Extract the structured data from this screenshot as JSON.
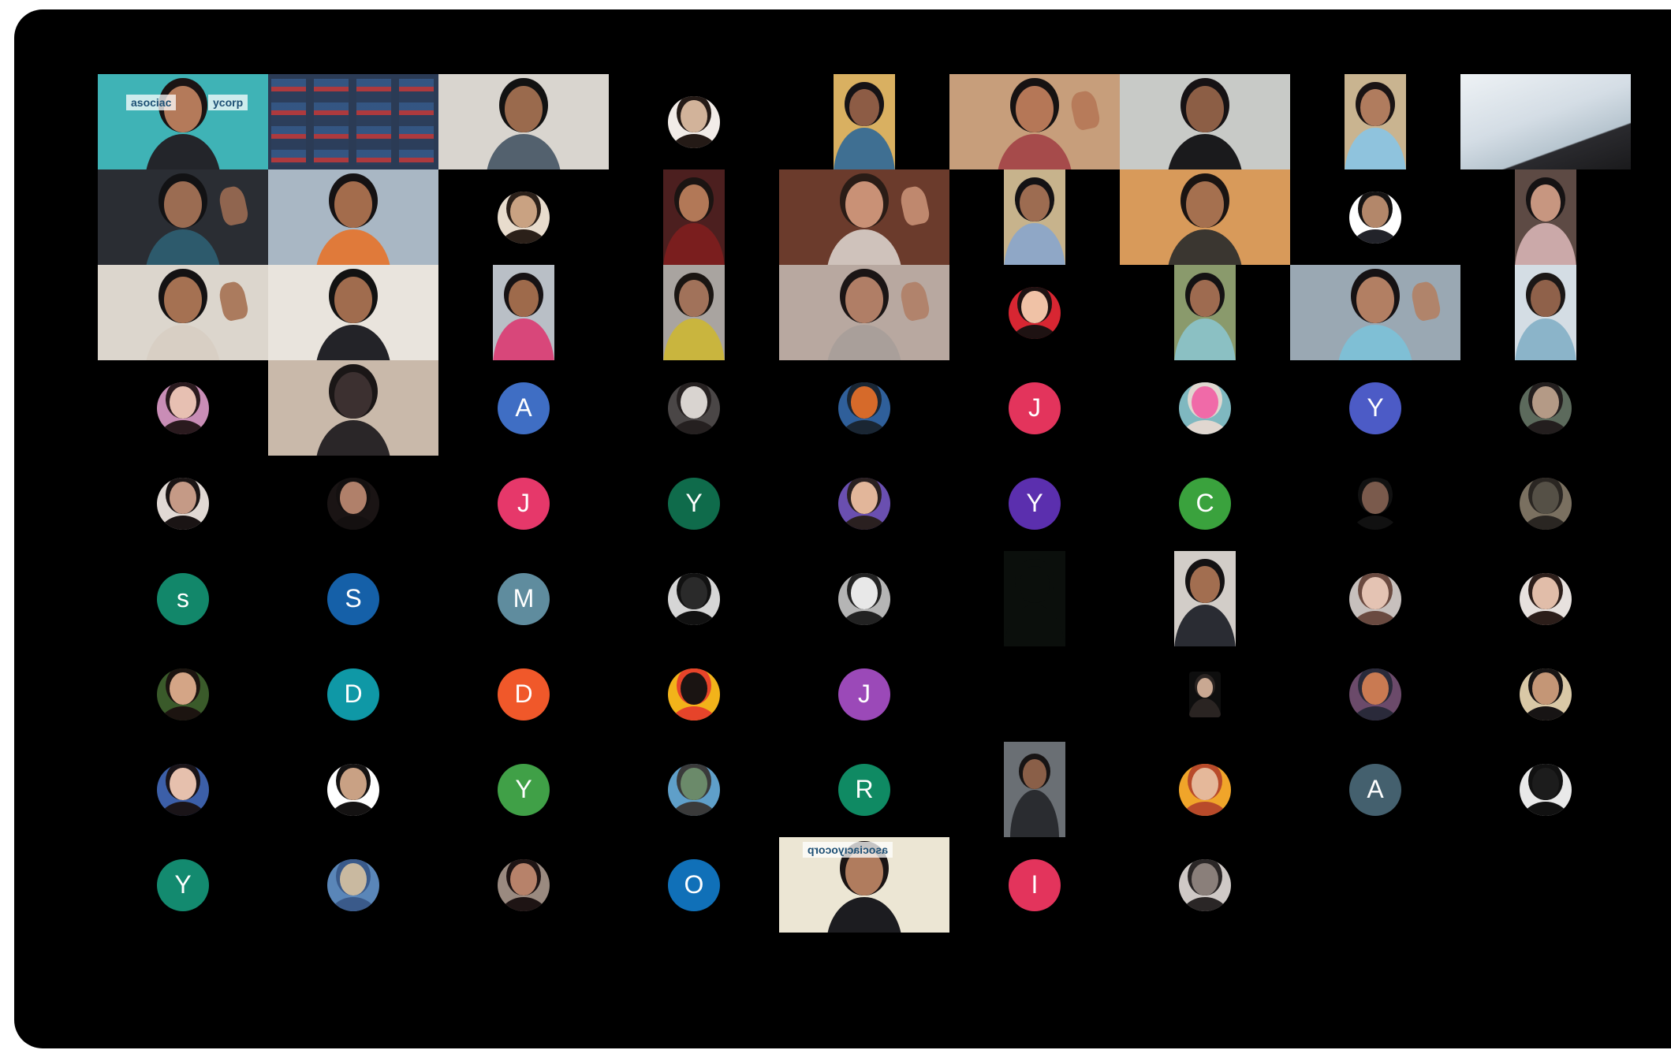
{
  "window": {
    "background": "#000000"
  },
  "participants": [
    {
      "row": 0,
      "col": 0,
      "kind": "video",
      "tile": "full",
      "bg": "#3fb3b6",
      "skin": "#b47a5a",
      "hair": "#1b1414",
      "shirt": "#23252a",
      "banner": "asociac",
      "banner2": "ycorp"
    },
    {
      "row": 0,
      "col": 1,
      "kind": "video",
      "tile": "full",
      "bg": "#2b3b55",
      "skin": "#3a4d66",
      "hair": "#2b3b55",
      "shirt": "#33629c",
      "pattern": "shelves"
    },
    {
      "row": 0,
      "col": 2,
      "kind": "video",
      "tile": "full",
      "bg": "#d9d5cf",
      "skin": "#9a6a4d",
      "hair": "#121212",
      "shirt": "#53616e"
    },
    {
      "row": 0,
      "col": 3,
      "kind": "avatar-photo",
      "bg": "#f2ece8",
      "skin": "#d2b39a",
      "hair": "#241a16"
    },
    {
      "row": 0,
      "col": 4,
      "kind": "video",
      "tile": "portrait",
      "bg": "#d9b061",
      "skin": "#8d5c45",
      "hair": "#151215",
      "shirt": "#3f6f92"
    },
    {
      "row": 0,
      "col": 5,
      "kind": "video",
      "tile": "full",
      "bg": "#c79e7b",
      "skin": "#b57757",
      "hair": "#161212",
      "shirt": "#a64b4b",
      "hand": true
    },
    {
      "row": 0,
      "col": 6,
      "kind": "video",
      "tile": "full",
      "bg": "#c8cac7",
      "skin": "#8c5e45",
      "hair": "#161214",
      "shirt": "#1a1a1c"
    },
    {
      "row": 0,
      "col": 7,
      "kind": "video",
      "tile": "portrait",
      "bg": "#c9b490",
      "skin": "#b07c5e",
      "hair": "#1a1414",
      "shirt": "#8fc3dd"
    },
    {
      "row": 0,
      "col": 8,
      "kind": "video",
      "tile": "full",
      "bg": "#d8e0e5",
      "skin": "#d8e0e5",
      "hair": "#d8e0e5",
      "shirt": "#1a1a1c",
      "pattern": "paper"
    },
    {
      "row": 1,
      "col": 0,
      "kind": "video",
      "tile": "full",
      "bg": "#2a2d33",
      "skin": "#9b6c52",
      "hair": "#121214",
      "shirt": "#2d5a6c",
      "hand": true
    },
    {
      "row": 1,
      "col": 1,
      "kind": "video",
      "tile": "full",
      "bg": "#a9b7c4",
      "skin": "#a36c4c",
      "hair": "#151213",
      "shirt": "#e07a3a"
    },
    {
      "row": 1,
      "col": 2,
      "kind": "avatar-photo",
      "bg": "#e8dccd",
      "skin": "#c9a282",
      "hair": "#2b2019"
    },
    {
      "row": 1,
      "col": 3,
      "kind": "video",
      "tile": "portrait",
      "bg": "#4c1f1f",
      "skin": "#b27857",
      "hair": "#1b1412",
      "shirt": "#7a1e1e"
    },
    {
      "row": 1,
      "col": 4,
      "kind": "video",
      "tile": "full",
      "bg": "#6b3b2c",
      "skin": "#c99176",
      "hair": "#2a1c16",
      "shirt": "#cfc2bb",
      "hand": true
    },
    {
      "row": 1,
      "col": 5,
      "kind": "video",
      "tile": "portrait",
      "bg": "#c7b38c",
      "skin": "#9d6c51",
      "hair": "#141214",
      "shirt": "#8fa7c6"
    },
    {
      "row": 1,
      "col": 6,
      "kind": "video",
      "tile": "full",
      "bg": "#d89a5a",
      "skin": "#a5704f",
      "hair": "#1a1412",
      "shirt": "#3a3630"
    },
    {
      "row": 1,
      "col": 7,
      "kind": "avatar-photo",
      "bg": "#ffffff",
      "skin": "#b3876a",
      "hair": "#141212",
      "shirt": "#22232a"
    },
    {
      "row": 1,
      "col": 8,
      "kind": "video",
      "tile": "portrait",
      "bg": "#5d4a44",
      "skin": "#c79680",
      "hair": "#151213",
      "shirt": "#cba9a9"
    },
    {
      "row": 2,
      "col": 0,
      "kind": "video",
      "tile": "full",
      "bg": "#dcd6cd",
      "skin": "#a57152",
      "hair": "#141213",
      "shirt": "#d8cfc4",
      "hand": true
    },
    {
      "row": 2,
      "col": 1,
      "kind": "video",
      "tile": "full",
      "bg": "#e9e4dd",
      "skin": "#a06c4e",
      "hair": "#121212",
      "shirt": "#232328"
    },
    {
      "row": 2,
      "col": 2,
      "kind": "video",
      "tile": "portrait",
      "bg": "#b9bfc6",
      "skin": "#9e6a4b",
      "hair": "#161214",
      "shirt": "#d8477a"
    },
    {
      "row": 2,
      "col": 3,
      "kind": "video",
      "tile": "portrait",
      "bg": "#a9a4a0",
      "skin": "#a1725a",
      "hair": "#1a1512",
      "shirt": "#c9b53e"
    },
    {
      "row": 2,
      "col": 4,
      "kind": "video",
      "tile": "full",
      "bg": "#b8a8a0",
      "skin": "#b07e66",
      "hair": "#1b1515",
      "shirt": "#a99f9a",
      "hand": true
    },
    {
      "row": 2,
      "col": 5,
      "kind": "avatar-photo",
      "bg": "#d72632",
      "skin": "#f0c2a6",
      "hair": "#1e1212"
    },
    {
      "row": 2,
      "col": 6,
      "kind": "video",
      "tile": "portrait",
      "bg": "#8a9a6c",
      "skin": "#9e6b50",
      "hair": "#141213",
      "shirt": "#8bc0c3"
    },
    {
      "row": 2,
      "col": 7,
      "kind": "video",
      "tile": "full",
      "bg": "#9aa8b3",
      "skin": "#b27f63",
      "hair": "#161214",
      "shirt": "#7fbfd5",
      "hand": true
    },
    {
      "row": 2,
      "col": 8,
      "kind": "video",
      "tile": "portrait",
      "bg": "#d4dde4",
      "skin": "#8f614a",
      "hair": "#1b1716",
      "shirt": "#8bb4c9"
    },
    {
      "row": 3,
      "col": 0,
      "kind": "avatar-photo",
      "bg": "#c98db6",
      "skin": "#e7c0b2",
      "hair": "#2a1a1e"
    },
    {
      "row": 3,
      "col": 1,
      "kind": "video",
      "tile": "full",
      "bg": "#c9b9aa",
      "skin": "#3c3030",
      "hair": "#1a1616",
      "shirt": "#2a2628"
    },
    {
      "row": 3,
      "col": 2,
      "kind": "avatar",
      "initial": "A",
      "color": "#3f6ec4"
    },
    {
      "row": 3,
      "col": 3,
      "kind": "avatar-photo",
      "bg": "#4a4646",
      "skin": "#d9d4d0",
      "hair": "#252020"
    },
    {
      "row": 3,
      "col": 4,
      "kind": "avatar-photo",
      "bg": "#2f5f9a",
      "skin": "#d66a2a",
      "hair": "#1a2633"
    },
    {
      "row": 3,
      "col": 5,
      "kind": "avatar",
      "initial": "J",
      "color": "#e3345c"
    },
    {
      "row": 3,
      "col": 6,
      "kind": "avatar-photo",
      "bg": "#7fb8c0",
      "skin": "#f06aa8",
      "hair": "#e0d7d0"
    },
    {
      "row": 3,
      "col": 7,
      "kind": "avatar",
      "initial": "Y",
      "color": "#4c5bc6"
    },
    {
      "row": 3,
      "col": 8,
      "kind": "avatar-photo",
      "bg": "#5c6a5c",
      "skin": "#b49a86",
      "hair": "#231e1e"
    },
    {
      "row": 4,
      "col": 0,
      "kind": "avatar-photo",
      "bg": "#e1d9d4",
      "skin": "#c59a86",
      "hair": "#1a1414"
    },
    {
      "row": 4,
      "col": 1,
      "kind": "avatar-photo",
      "bg": "#1a1414",
      "skin": "#b0806a",
      "hair": "#141010"
    },
    {
      "row": 4,
      "col": 2,
      "kind": "avatar",
      "initial": "J",
      "color": "#e6386a"
    },
    {
      "row": 4,
      "col": 3,
      "kind": "avatar",
      "initial": "Y",
      "color": "#0f6b4b"
    },
    {
      "row": 4,
      "col": 4,
      "kind": "avatar-photo",
      "bg": "#6a4fb0",
      "skin": "#e2b69a",
      "hair": "#2a2020"
    },
    {
      "row": 4,
      "col": 5,
      "kind": "avatar",
      "initial": "Y",
      "color": "#5b2fae"
    },
    {
      "row": 4,
      "col": 6,
      "kind": "avatar",
      "initial": "C",
      "color": "#3aa23d"
    },
    {
      "row": 4,
      "col": 7,
      "kind": "avatar-photo",
      "bg": "#000000",
      "skin": "#7a5a4c",
      "hair": "#111111"
    },
    {
      "row": 4,
      "col": 8,
      "kind": "avatar-photo",
      "bg": "#7a7060",
      "skin": "#555046",
      "hair": "#2a2622"
    },
    {
      "row": 5,
      "col": 0,
      "kind": "avatar",
      "initial": "s",
      "color": "#12876a"
    },
    {
      "row": 5,
      "col": 1,
      "kind": "avatar",
      "initial": "S",
      "color": "#1560a8"
    },
    {
      "row": 5,
      "col": 2,
      "kind": "avatar",
      "initial": "M",
      "color": "#5f8c9e"
    },
    {
      "row": 5,
      "col": 3,
      "kind": "avatar-photo",
      "bg": "#d6d6d6",
      "skin": "#2a2a2a",
      "hair": "#111111"
    },
    {
      "row": 5,
      "col": 4,
      "kind": "avatar-photo",
      "bg": "#b5b5b5",
      "skin": "#e8e8e8",
      "hair": "#222222"
    },
    {
      "row": 5,
      "col": 5,
      "kind": "video",
      "tile": "portrait",
      "bg": "#0b0f0c",
      "skin": "#0b0f0c",
      "hair": "#0b0f0c",
      "shirt": "#0b0f0c"
    },
    {
      "row": 5,
      "col": 6,
      "kind": "video",
      "tile": "portrait",
      "bg": "#d2cdc8",
      "skin": "#a26e50",
      "hair": "#141213",
      "shirt": "#2a2c33"
    },
    {
      "row": 5,
      "col": 7,
      "kind": "avatar-photo",
      "bg": "#c7c0bd",
      "skin": "#e4c3b3",
      "hair": "#6a4a40"
    },
    {
      "row": 5,
      "col": 8,
      "kind": "avatar-photo",
      "bg": "#e7e1de",
      "skin": "#e1bda9",
      "hair": "#2c1e1a"
    },
    {
      "row": 6,
      "col": 0,
      "kind": "avatar-photo",
      "bg": "#3a5a2a",
      "skin": "#d4a586",
      "hair": "#1c1410"
    },
    {
      "row": 6,
      "col": 1,
      "kind": "avatar",
      "initial": "D",
      "color": "#0f98a6"
    },
    {
      "row": 6,
      "col": 2,
      "kind": "avatar",
      "initial": "D",
      "color": "#f0582a"
    },
    {
      "row": 6,
      "col": 3,
      "kind": "avatar-photo",
      "bg": "#f2b31a",
      "skin": "#1a1412",
      "hair": "#e6442a"
    },
    {
      "row": 6,
      "col": 4,
      "kind": "avatar",
      "initial": "J",
      "color": "#9b49b8"
    },
    {
      "row": 6,
      "col": 6,
      "kind": "avatar-photo",
      "bg": "#0e0e0e",
      "skin": "#c9a892",
      "hair": "#2a2422",
      "small": true
    },
    {
      "row": 6,
      "col": 7,
      "kind": "avatar-photo",
      "bg": "#6b4a6a",
      "skin": "#c97a52",
      "hair": "#2a2a3a"
    },
    {
      "row": 6,
      "col": 8,
      "kind": "avatar-photo",
      "bg": "#d9c8a6",
      "skin": "#c49676",
      "hair": "#171414"
    },
    {
      "row": 7,
      "col": 0,
      "kind": "avatar-photo",
      "bg": "#3c5fa8",
      "skin": "#e6c0ad",
      "hair": "#1a1418"
    },
    {
      "row": 7,
      "col": 1,
      "kind": "avatar-photo",
      "bg": "#ffffff",
      "skin": "#c9a184",
      "hair": "#141212"
    },
    {
      "row": 7,
      "col": 2,
      "kind": "avatar",
      "initial": "Y",
      "color": "#40a047"
    },
    {
      "row": 7,
      "col": 3,
      "kind": "avatar-photo",
      "bg": "#5f9fc9",
      "skin": "#6b8a6a",
      "hair": "#3a3a3a"
    },
    {
      "row": 7,
      "col": 4,
      "kind": "avatar",
      "initial": "R",
      "color": "#0f8a63"
    },
    {
      "row": 7,
      "col": 5,
      "kind": "video",
      "tile": "tall",
      "bg": "#6a6f74",
      "skin": "#8a5f48",
      "hair": "#171414",
      "shirt": "#2a2c30"
    },
    {
      "row": 7,
      "col": 6,
      "kind": "avatar-photo",
      "bg": "#f0a52a",
      "skin": "#e5b89a",
      "hair": "#b84a2a"
    },
    {
      "row": 7,
      "col": 7,
      "kind": "avatar",
      "initial": "A",
      "color": "#44606e"
    },
    {
      "row": 7,
      "col": 8,
      "kind": "avatar-photo",
      "bg": "#e9e9e9",
      "skin": "#1c1c1c",
      "hair": "#111111"
    },
    {
      "row": 8,
      "col": 0,
      "kind": "avatar",
      "initial": "Y",
      "color": "#138a6f"
    },
    {
      "row": 8,
      "col": 1,
      "kind": "avatar-photo",
      "bg": "#5a86b8",
      "skin": "#c9b9a0",
      "hair": "#3a5a8a"
    },
    {
      "row": 8,
      "col": 2,
      "kind": "avatar-photo",
      "bg": "#9a8a80",
      "skin": "#b7826a",
      "hair": "#1e1414"
    },
    {
      "row": 8,
      "col": 3,
      "kind": "avatar",
      "initial": "O",
      "color": "#1070b8"
    },
    {
      "row": 8,
      "col": 4,
      "kind": "video",
      "tile": "full",
      "bg": "#ece6d4",
      "skin": "#b07c5e",
      "hair": "#1a1414",
      "shirt": "#1c1c20",
      "banner": "asociacıyocorp",
      "mirrorBanner": true
    },
    {
      "row": 8,
      "col": 5,
      "kind": "avatar",
      "initial": "I",
      "color": "#e3345c"
    },
    {
      "row": 8,
      "col": 6,
      "kind": "avatar-photo",
      "bg": "#cfc9c6",
      "skin": "#8a7f7a",
      "hair": "#2a2626"
    }
  ]
}
